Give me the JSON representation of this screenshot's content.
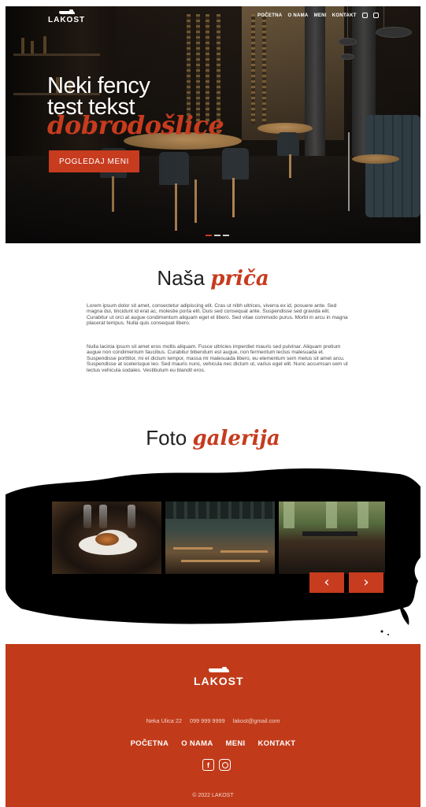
{
  "brand": {
    "name": "LAKOST"
  },
  "nav": {
    "items": [
      "POČETNA",
      "O NAMA",
      "MENI",
      "KONTAKT"
    ],
    "social": [
      "facebook-icon",
      "instagram-icon"
    ]
  },
  "hero": {
    "title_line1": "Neki fency",
    "title_line2": "test tekst",
    "title_script": "dobrodošlice",
    "cta_label": "POGLEDAJ MENI",
    "slides": 3
  },
  "story": {
    "title_plain": "Naša",
    "title_script": "priča",
    "paragraph1": "Lorem ipsum dolor sit amet, consectetur adipiscing elit. Cras ut nibh ultrices, viverra ex id, posuere ante. Sed magna dui, tincidunt id erat ac, molestie porta elit. Duis sed consequat ante. Suspendisse sed gravida elit. Curabitur ut orci at augue condimentum aliquam eget et libero. Sed vitae commodo purus. Morbi in arcu in magna placerat tempus. Nulla quis consequat libero.",
    "paragraph2": "Nulla lacinia ipsum sit amet eros mollis aliquam. Fusce ultricies imperdiet mauris sed pulvinar. Aliquam pretium augue non condimentum faucibus. Curabitur bibendum est augue, non fermentum lectus malesuada et. Suspendisse porttitor, mi et dictum tempor, massa mi malesuada libero, eu elementum sem metus sit amet arcu. Suspendisse at scelerisque leo. Sed mauris nunc, vehicula nec dictum ut, varius eget elit. Nunc accumsan sem ut lectus vehicula sodales. Vestibulum eu blandit eros."
  },
  "gallery": {
    "title_plain": "Foto",
    "title_script": "galerija",
    "prev_label": "‹",
    "next_label": "›"
  },
  "footer": {
    "address": "Neka Ulica 22",
    "phone": "099 999 9999",
    "email": "lakost@gmail.com",
    "nav": [
      "POČETNA",
      "O NAMA",
      "MENI",
      "KONTAKT"
    ],
    "social": [
      "facebook-icon",
      "instagram-icon"
    ],
    "copyright": "© 2022 LAKOST"
  },
  "colors": {
    "accent": "#c73b1e",
    "footer_bg": "#c13b1a",
    "dark": "#000000"
  }
}
